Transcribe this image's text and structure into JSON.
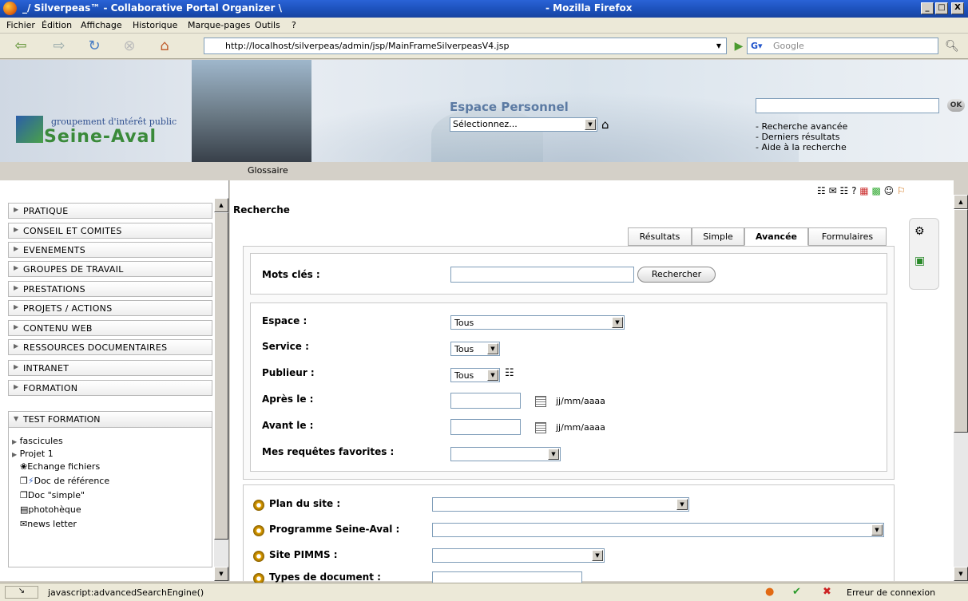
{
  "window": {
    "title": "_/ Silverpeas™ - Collaborative Portal Organizer \\",
    "app": "- Mozilla Firefox",
    "minimize": "_",
    "maximize": "□",
    "close": "X"
  },
  "menu": [
    "Fichier",
    "Édition",
    "Affichage",
    "Historique",
    "Marque-pages",
    "Outils",
    "?"
  ],
  "toolbar": {
    "url": "http://localhost/silverpeas/admin/jsp/MainFrameSilverpeasV4.jsp",
    "search_placeholder": "Google"
  },
  "banner": {
    "logo_line1": "groupement d'intérêt public",
    "logo_line2": "Seine-Aval",
    "espace_title": "Espace Personnel",
    "espace_select": "Sélectionnez...",
    "ok_label": "OK",
    "links": [
      "- Recherche avancée",
      "- Derniers résultats",
      "- Aide à la recherche"
    ],
    "glossaire": "Glossaire"
  },
  "sidebar": {
    "menus": [
      "PRATIQUE",
      "CONSEIL ET COMITES",
      "EVENEMENTS",
      "GROUPES DE TRAVAIL",
      "PRESTATIONS",
      "PROJETS / ACTIONS",
      "CONTENU WEB",
      "RESSOURCES DOCUMENTAIRES",
      "INTRANET",
      "FORMATION"
    ],
    "test_formation": {
      "title": "TEST FORMATION",
      "items": [
        "fascicules",
        "Projet 1",
        "Echange fichiers",
        "Doc de référence",
        "Doc \"simple\"",
        "photohèque",
        "news letter"
      ]
    }
  },
  "main": {
    "title": "Recherche",
    "tabs": [
      "Résultats",
      "Simple",
      "Avancée",
      "Formulaires"
    ],
    "active_tab": "Avancée",
    "keywords_label": "Mots clés :",
    "search_button": "Rechercher",
    "espace_label": "Espace :",
    "espace_value": "Tous",
    "service_label": "Service :",
    "service_value": "Tous",
    "publieur_label": "Publieur :",
    "publieur_value": "Tous",
    "apres_label": "Après le :",
    "avant_label": "Avant le :",
    "date_hint": "jj/mm/aaaa",
    "favorites_label": "Mes requêtes favorites :",
    "plan_label": "Plan du site :",
    "programme_label": "Programme Seine-Aval :",
    "pimms_label": "Site PIMMS :",
    "types_label": "Types de document :"
  },
  "status": {
    "text": "javascript:advancedSearchEngine()",
    "error": "Erreur de connexion"
  },
  "colors": {
    "titlebar": "#2a63d6",
    "accent": "#5b7aa3"
  }
}
